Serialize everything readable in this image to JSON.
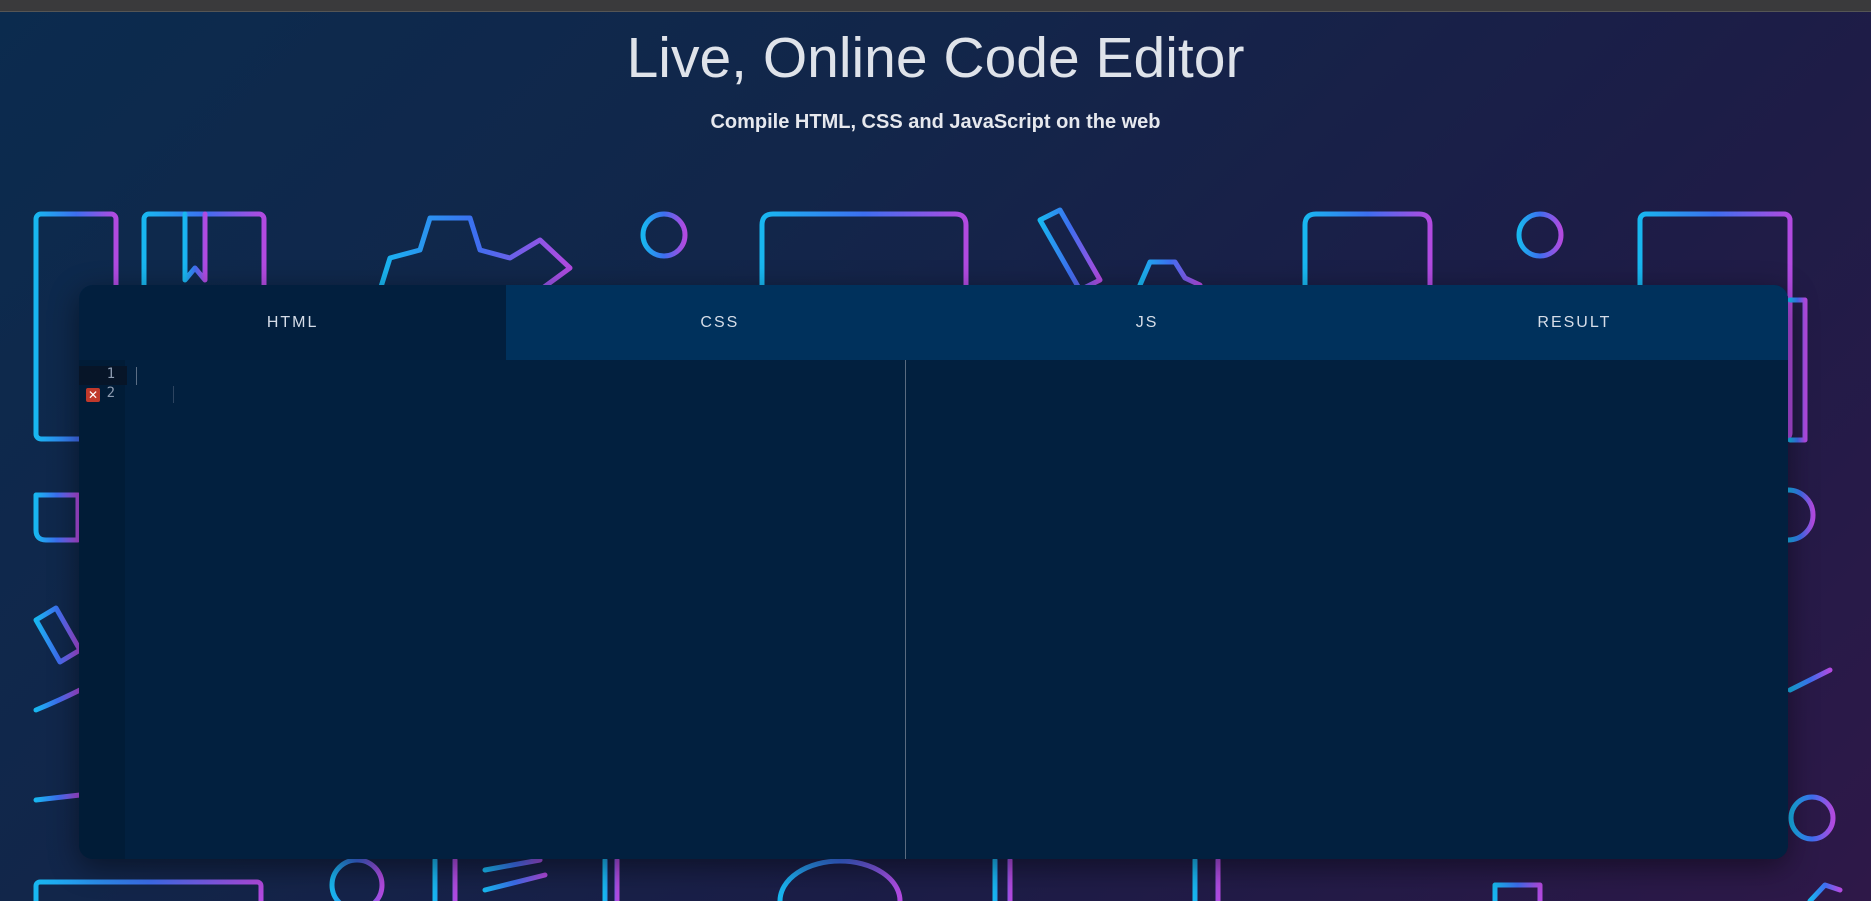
{
  "header": {
    "title": "Live, Online Code Editor",
    "subtitle": "Compile HTML, CSS and JavaScript on the web"
  },
  "tabs": [
    {
      "label": "HTML",
      "active": true
    },
    {
      "label": "CSS",
      "active": false
    },
    {
      "label": "JS",
      "active": false
    },
    {
      "label": "RESULT",
      "active": false
    }
  ],
  "editor": {
    "line_numbers": [
      "1",
      "2"
    ],
    "error_line": "2",
    "error_icon": "error-x-icon"
  },
  "colors": {
    "tab_bar": "#00315c",
    "active_tab": "#021f3e",
    "editor_bg": "#02203f",
    "error": "#c0392b"
  }
}
